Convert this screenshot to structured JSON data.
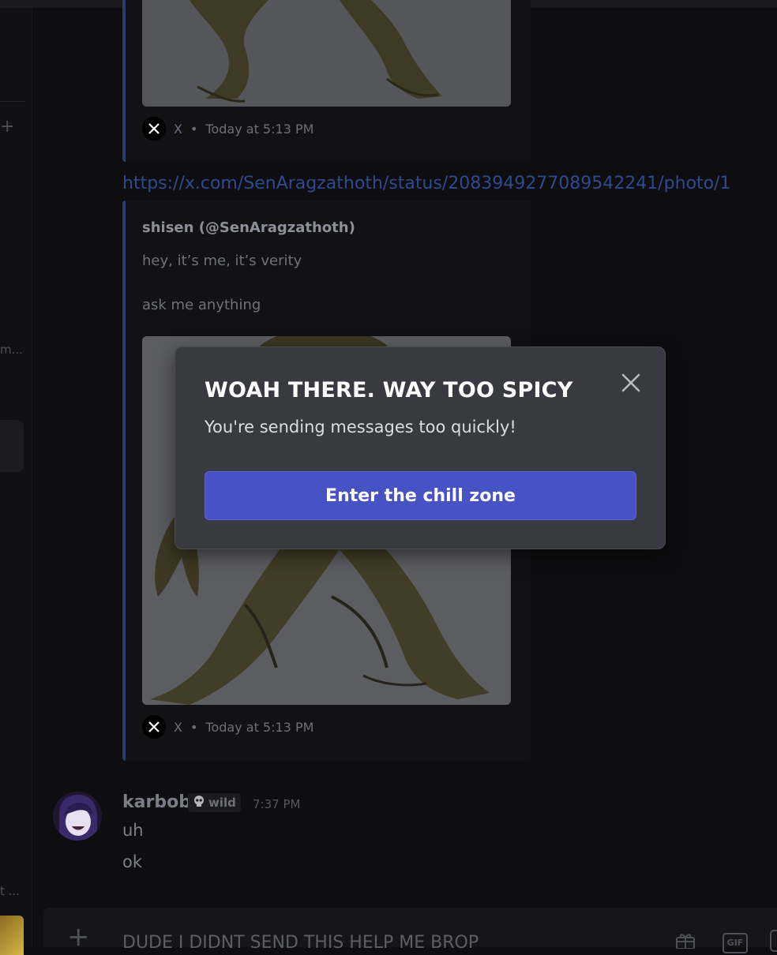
{
  "embeds": [
    {
      "source": "X",
      "separator": "•",
      "timestamp": "Today at 5:13 PM"
    },
    {
      "author": "shisen (@SenAragzathoth)",
      "description": [
        "hey, it’s me, it’s verity",
        "ask me anything"
      ],
      "source": "X",
      "separator": "•",
      "timestamp": "Today at 5:13 PM"
    }
  ],
  "link": "https://x.com/SenAragzathoth/status/2083949277089542241/photo/1",
  "message": {
    "author": "karbob",
    "tag": "wild",
    "tag_icon": "skull-icon",
    "time": "7:37 PM",
    "lines": [
      "uh",
      "ok"
    ]
  },
  "composer": {
    "text": "DUDE I DIDNT SEND THIS HELP ME BROP",
    "gif_label": "GIF"
  },
  "modal": {
    "title": "WOAH THERE. WAY TOO SPICY",
    "subtitle": "You're sending messages too quickly!",
    "button_label": "Enter the chill zone"
  },
  "sidebar": {
    "truncated_1": "m...",
    "truncated_2": "t ..."
  },
  "colors": {
    "modal_bg": "#393a41",
    "button_bg": "#4752c4",
    "link": "#2e4a8e",
    "embed_border": "#263d74"
  }
}
